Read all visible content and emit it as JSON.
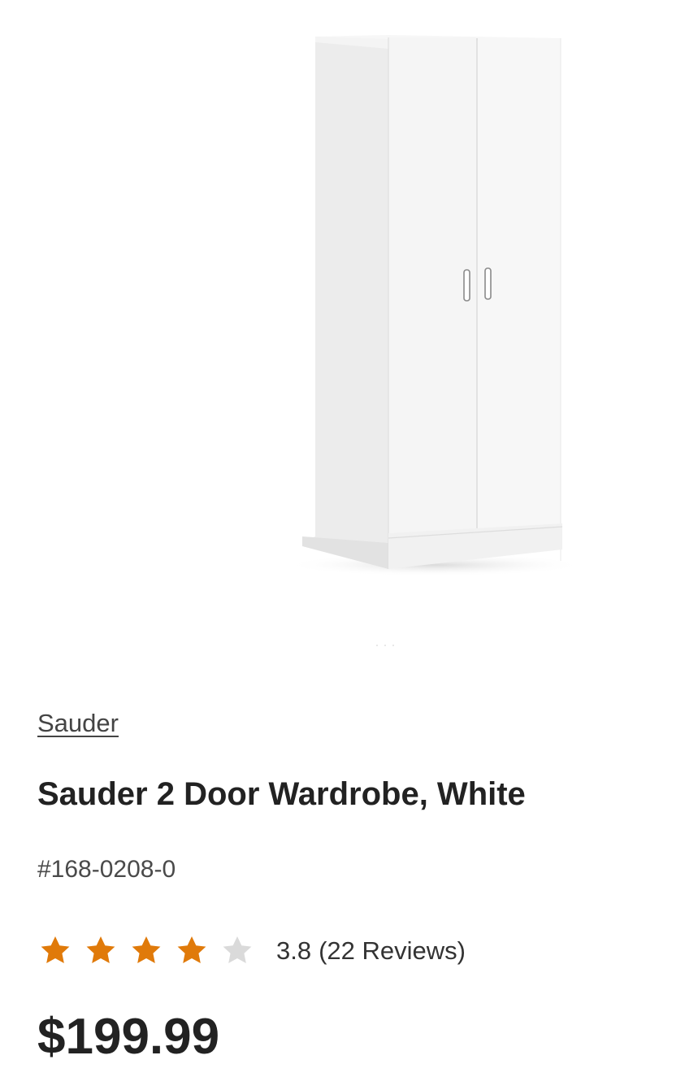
{
  "product": {
    "image_alt": "white two-door wardrobe",
    "brand": "Sauder",
    "title": "Sauder 2 Door Wardrobe, White",
    "sku": "#168-0208-0",
    "rating": {
      "value": 3.8,
      "value_text": "3.8",
      "reviews_text": "(22 Reviews)",
      "stars_total": 5,
      "stars_filled": 4
    },
    "price": "$199.99"
  },
  "colors": {
    "star_filled": "#E07A0A",
    "star_empty": "#DADADA",
    "text": "#222222"
  },
  "icons": [
    "star-filled-icon",
    "star-empty-icon"
  ]
}
